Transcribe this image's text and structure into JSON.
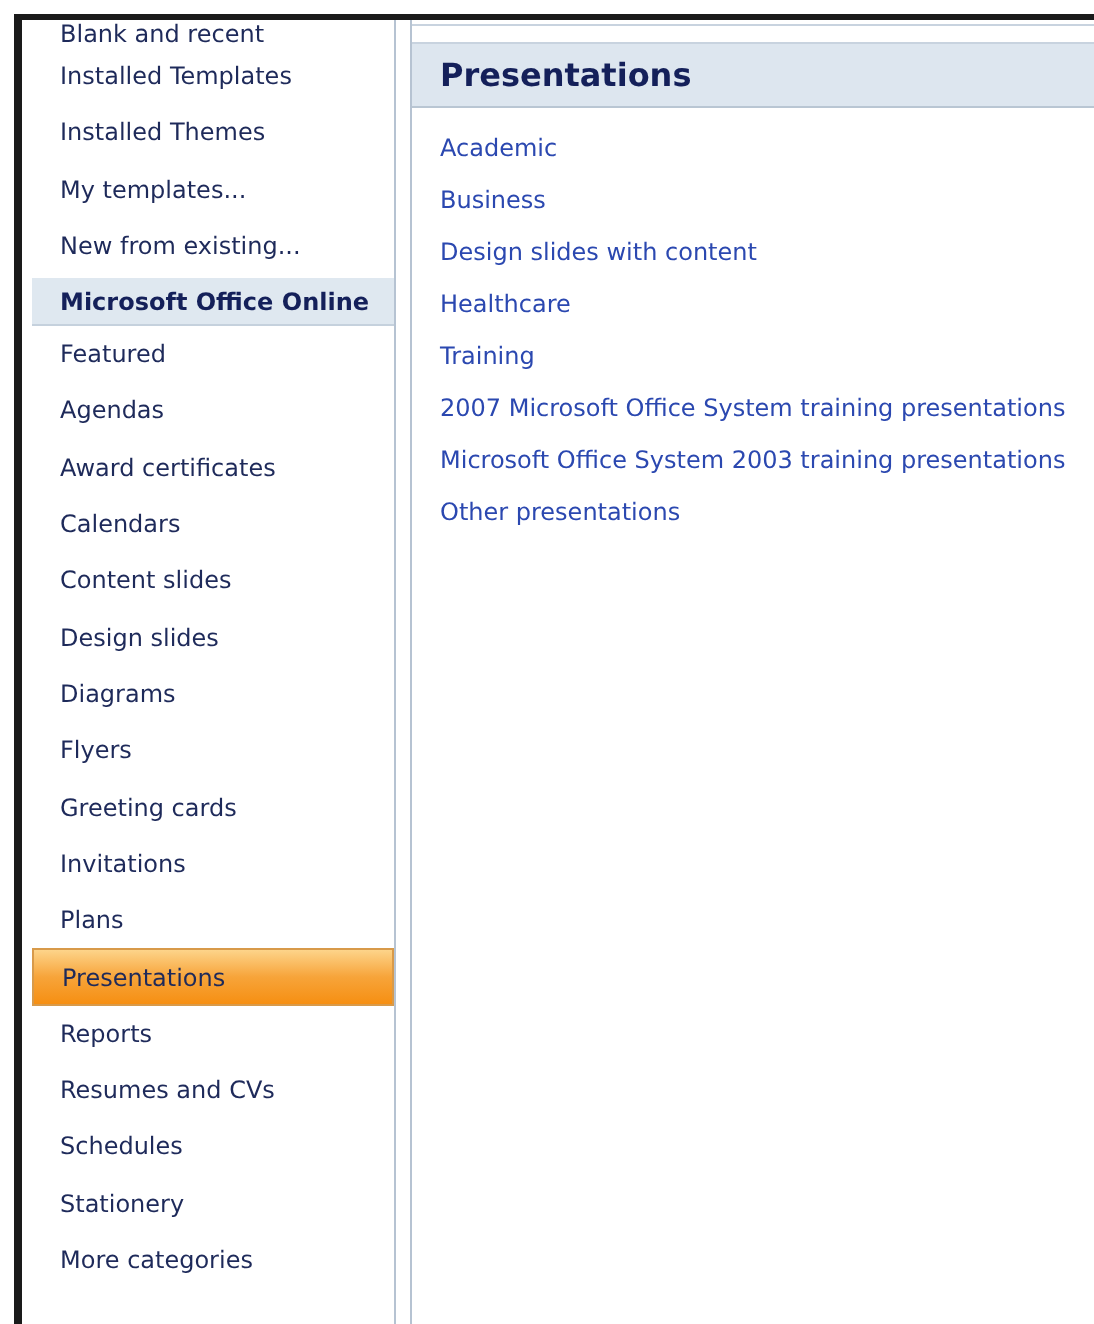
{
  "sidebar": {
    "items": [
      {
        "label": "Blank and recent",
        "kind": "link",
        "selected": false
      },
      {
        "label": "Installed Templates",
        "kind": "link",
        "selected": false
      },
      {
        "label": "Installed Themes",
        "kind": "link",
        "selected": false
      },
      {
        "label": "My templates...",
        "kind": "link",
        "selected": false
      },
      {
        "label": "New from existing...",
        "kind": "link",
        "selected": false
      },
      {
        "label": "Microsoft Office Online",
        "kind": "header",
        "selected": false
      },
      {
        "label": "Featured",
        "kind": "link",
        "selected": false
      },
      {
        "label": "Agendas",
        "kind": "link",
        "selected": false
      },
      {
        "label": "Award certificates",
        "kind": "link",
        "selected": false
      },
      {
        "label": "Calendars",
        "kind": "link",
        "selected": false
      },
      {
        "label": "Content slides",
        "kind": "link",
        "selected": false
      },
      {
        "label": "Design slides",
        "kind": "link",
        "selected": false
      },
      {
        "label": "Diagrams",
        "kind": "link",
        "selected": false
      },
      {
        "label": "Flyers",
        "kind": "link",
        "selected": false
      },
      {
        "label": "Greeting cards",
        "kind": "link",
        "selected": false
      },
      {
        "label": "Invitations",
        "kind": "link",
        "selected": false
      },
      {
        "label": "Plans",
        "kind": "link",
        "selected": false
      },
      {
        "label": "Presentations",
        "kind": "link",
        "selected": true
      },
      {
        "label": "Reports",
        "kind": "link",
        "selected": false
      },
      {
        "label": "Resumes and CVs",
        "kind": "link",
        "selected": false
      },
      {
        "label": "Schedules",
        "kind": "link",
        "selected": false
      },
      {
        "label": "Stationery",
        "kind": "link",
        "selected": false
      },
      {
        "label": "More categories",
        "kind": "link",
        "selected": false
      }
    ]
  },
  "panel": {
    "title": "Presentations",
    "links": [
      "Academic",
      "Business",
      "Design slides with content",
      "Healthcare",
      "Training",
      "2007 Microsoft Office System training presentations",
      "Microsoft Office System 2003 training presentations",
      "Other presentations"
    ]
  }
}
